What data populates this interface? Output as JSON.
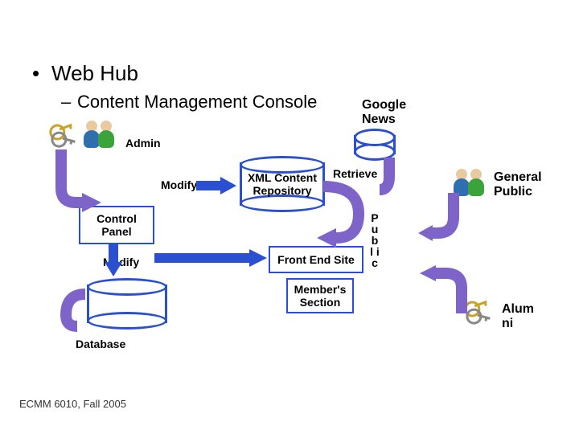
{
  "bullet1": "Web Hub",
  "bullet2": "Content Management Console",
  "labels": {
    "admin": "Admin",
    "modify1": "Modify",
    "modify2": "Modify",
    "xml1": "XML Content",
    "xml2": "Repository",
    "retrieve": "Retrieve",
    "google": "Google",
    "news": "News",
    "control": "Control",
    "panel": "Panel",
    "front": "Front End Site",
    "member1": "Member's",
    "member2": "Section",
    "database": "Database",
    "general": "General",
    "public": "Public",
    "alumni1": "Alum",
    "alumni2": "ni",
    "pub_v": "P u b l i c"
  },
  "footer": "ECMM 6010, Fall 2005"
}
